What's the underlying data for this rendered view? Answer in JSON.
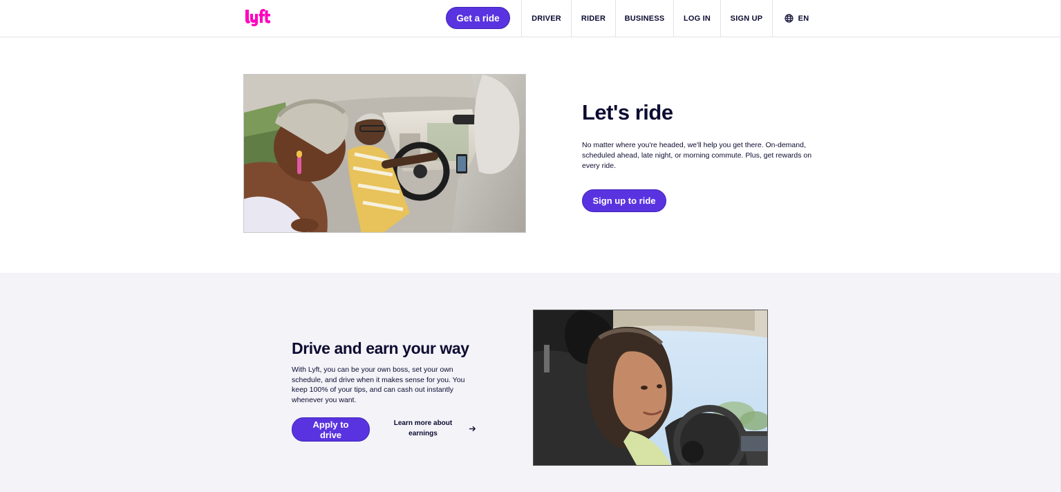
{
  "header": {
    "logo": "lyft",
    "cta_label": "Get a ride",
    "nav": [
      "DRIVER",
      "RIDER",
      "BUSINESS",
      "LOG IN",
      "SIGN UP"
    ],
    "language": "EN",
    "language_icon": "globe-icon"
  },
  "ride_section": {
    "title": "Let's ride",
    "body": "No matter where you're headed, we'll help you get there. On-demand, scheduled ahead, late night, or morning commute. Plus, get rewards on every ride.",
    "button_label": "Sign up to ride"
  },
  "drive_section": {
    "title": "Drive and earn your way",
    "body": "With Lyft, you can be your own boss, set your own schedule, and drive when it makes sense for you. You keep 100% of your tips, and can cash out instantly whenever you want.",
    "button_label": "Apply to drive",
    "learn_more_label": "Learn more about earnings",
    "learn_more_icon": "arrow-right-icon"
  },
  "colors": {
    "brand_pink": "#ff00bf",
    "primary_purple": "#5a33e0",
    "text_navy": "#0c0b31",
    "section_gray": "#f3f3f8"
  }
}
